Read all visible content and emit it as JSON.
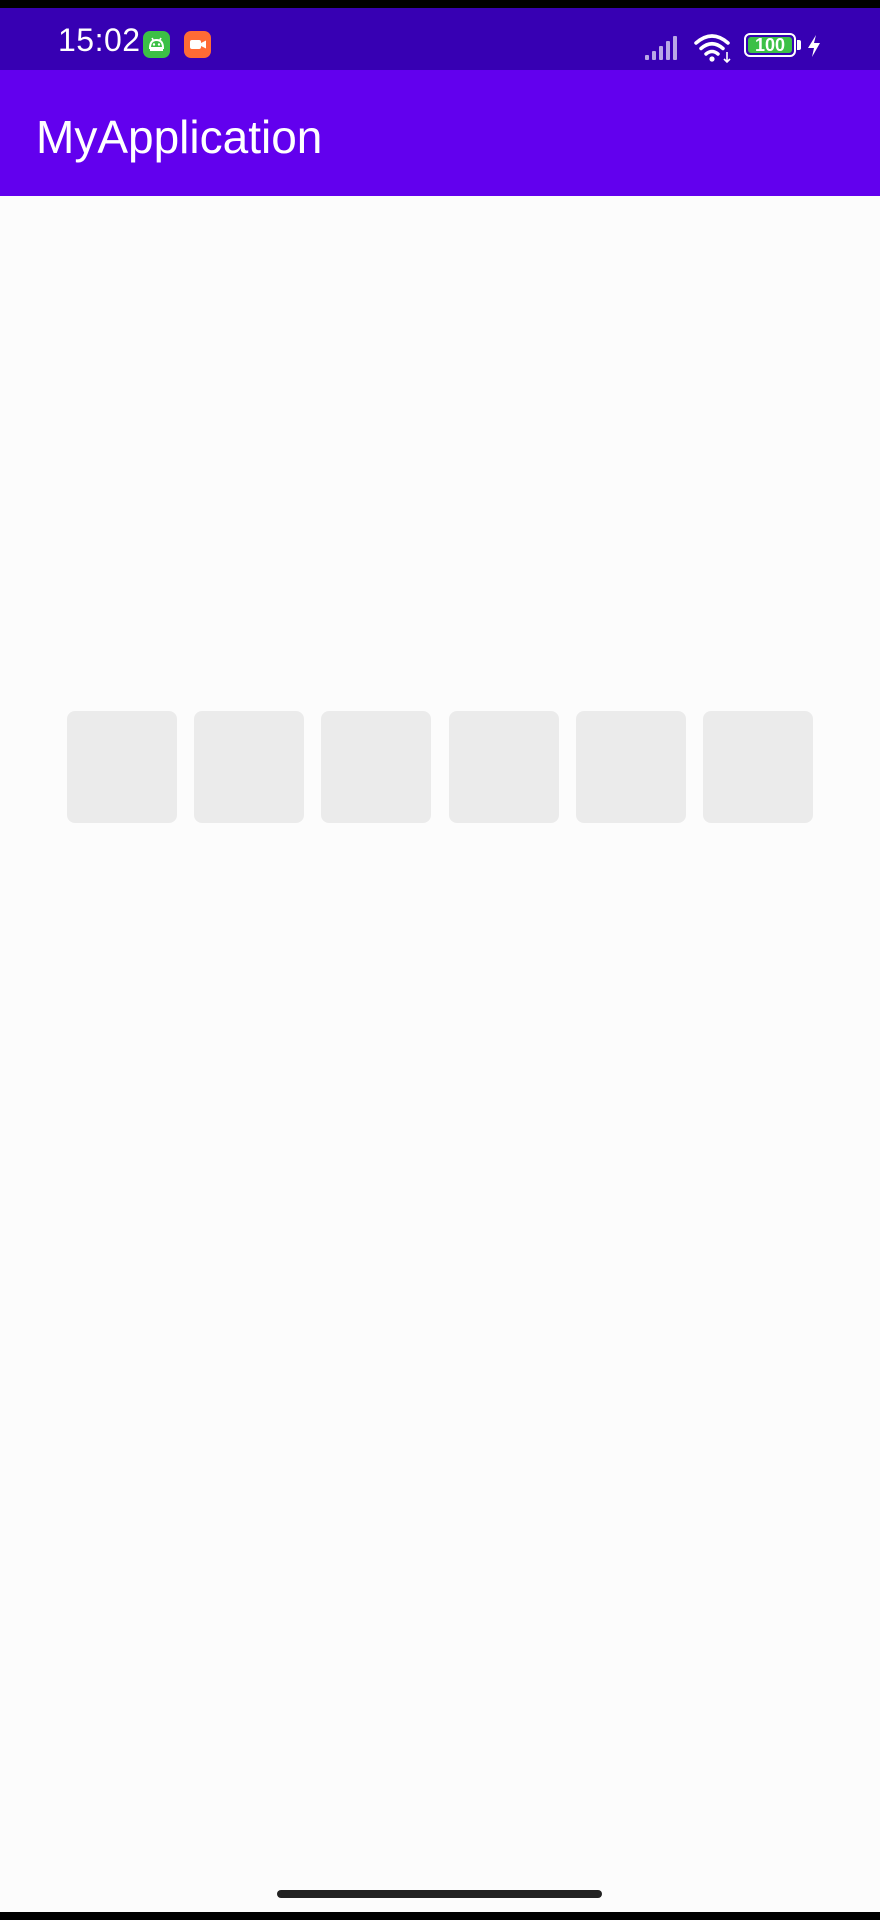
{
  "status_bar": {
    "time": "15:02",
    "battery_level": "100",
    "icons": [
      "android-app-icon",
      "video-recorder-icon",
      "signal-icon",
      "wifi-icon",
      "battery-icon",
      "charging-icon"
    ]
  },
  "app_bar": {
    "title": "MyApplication"
  },
  "code_input": {
    "box_count": 6,
    "values": [
      "",
      "",
      "",
      "",
      "",
      ""
    ]
  },
  "colors": {
    "status_bar": "#3700b3",
    "app_bar": "#6200ee",
    "background": "#fcfcfc",
    "code_box": "#ebebeb",
    "battery_fill": "#3cc046"
  }
}
